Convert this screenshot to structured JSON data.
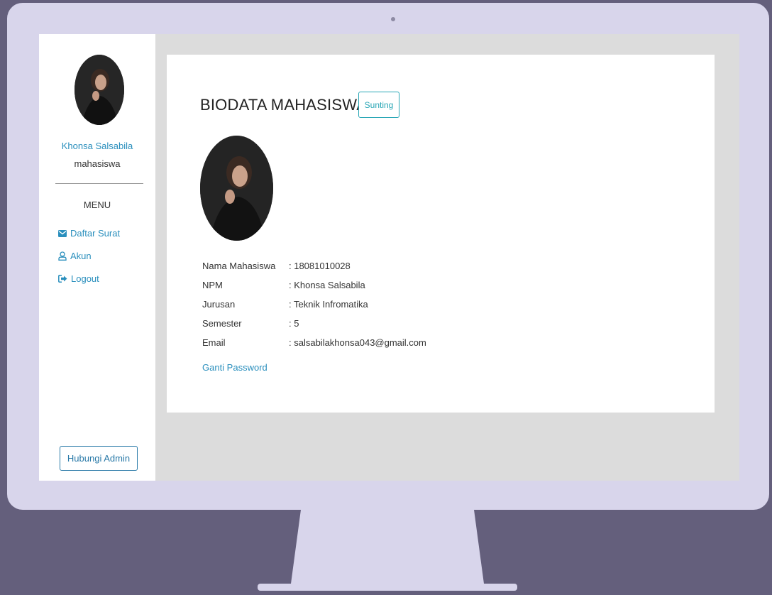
{
  "sidebar": {
    "user_name": "Khonsa Salsabila",
    "user_role": "mahasiswa",
    "menu_title": "MENU",
    "items": [
      {
        "label": "Daftar Surat",
        "icon": "envelope-icon"
      },
      {
        "label": "Akun",
        "icon": "user-icon"
      },
      {
        "label": "Logout",
        "icon": "logout-icon"
      }
    ],
    "contact_button": "Hubungi Admin"
  },
  "main": {
    "title": "BIODATA MAHASISWA",
    "edit_button": "Sunting",
    "fields": [
      {
        "label": "Nama Mahasiswa",
        "value": ": 18081010028"
      },
      {
        "label": "NPM",
        "value": ": Khonsa Salsabila"
      },
      {
        "label": "Jurusan",
        "value": ": Teknik Infromatika"
      },
      {
        "label": "Semester",
        "value": ": 5"
      },
      {
        "label": "Email",
        "value": ": salsabilakhonsa043@gmail.com"
      }
    ],
    "change_password_link": "Ganti Password"
  },
  "colors": {
    "background": "#645f7c",
    "monitor": "#d8d5eb",
    "link": "#2a8fbd",
    "edit_accent": "#2aa7b6"
  }
}
